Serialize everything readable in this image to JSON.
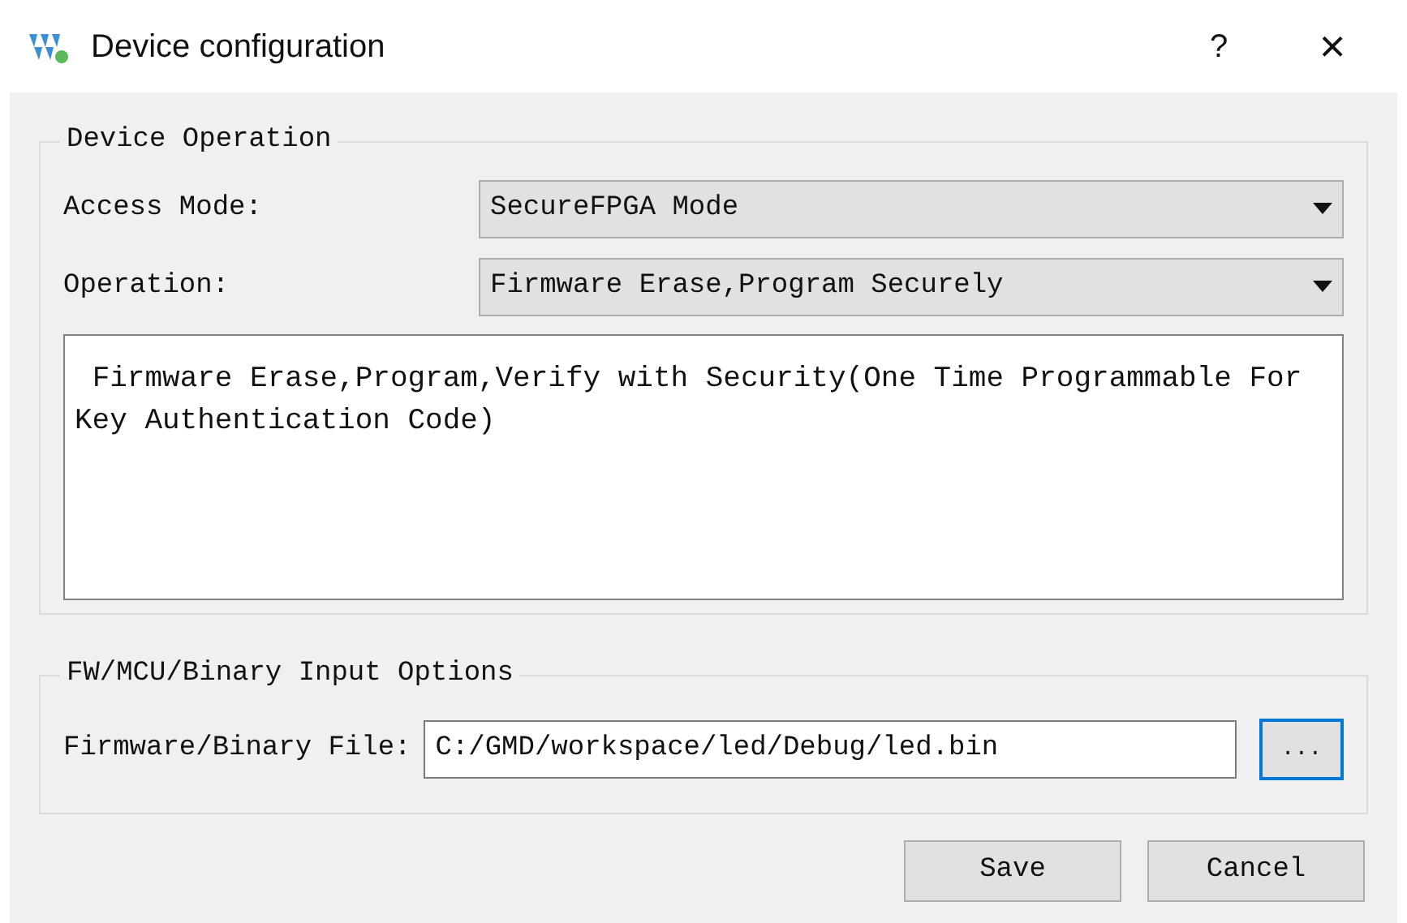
{
  "window": {
    "title": "Device configuration",
    "help": "?",
    "close": "×"
  },
  "device_operation": {
    "title": "Device Operation",
    "fields": [
      {
        "label": "Access Mode:",
        "value": "SecureFPGA Mode"
      },
      {
        "label": "Operation:",
        "value": "Firmware Erase,Program Securely"
      }
    ],
    "description": " Firmware Erase,Program,Verify with Security(One Time Programmable For Key Authentication Code)"
  },
  "input_options": {
    "title": "FW/MCU/Binary Input Options",
    "label": "Firmware/Binary File:",
    "value": "C:/GMD/workspace/led/Debug/led.bin",
    "browse": "..."
  },
  "buttons": [
    "Save",
    "Cancel"
  ]
}
